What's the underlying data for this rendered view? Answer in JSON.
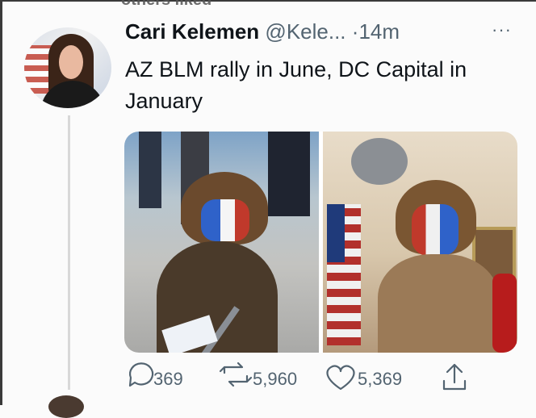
{
  "context_text": "others liked",
  "tweet": {
    "author_name": "Cari Kelemen",
    "author_handle": "@Kele...",
    "separator": "·",
    "time": "14m",
    "more_icon": "ellipsis-icon",
    "text": "AZ BLM rally in June, DC Capital in January"
  },
  "actions": {
    "reply_count": "369",
    "retweet_count": "5,960",
    "like_count": "5,369"
  },
  "colors": {
    "text": "#0f1419",
    "secondary": "#536471",
    "thread": "#d8d8d8"
  }
}
